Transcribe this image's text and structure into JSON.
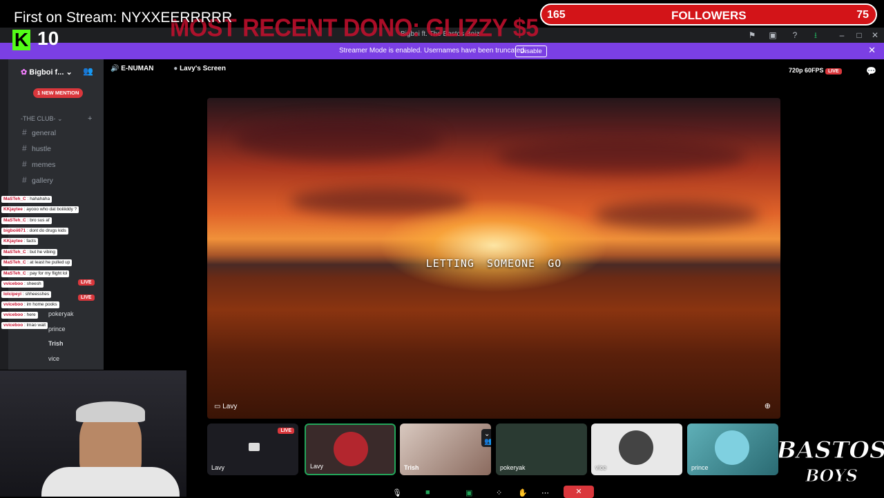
{
  "overlay": {
    "first_on_stream": "First on Stream: NYXXEERRRRR",
    "recent_dono": "MOST RECENT DONO: GLIZZY $5",
    "kick_count": "10",
    "followers_current": "165",
    "followers_label": "FOLLOWERS",
    "followers_goal": "75",
    "brand_logo": "BASTOS BOYS"
  },
  "window": {
    "title": "Bigboi ft. The Bastos Boiz"
  },
  "banner": {
    "message": "Streamer Mode is enabled. Usernames have been truncated.",
    "disable_label": "Disable"
  },
  "sidebar": {
    "server_name": "Bigboi f...",
    "mention_badge": "1 NEW MENTION",
    "category": "-THE CLUB-",
    "channels": [
      "general",
      "hustle",
      "memes",
      "gallery"
    ],
    "voice_users": [
      {
        "name": "pokeryak"
      },
      {
        "name": "prince"
      },
      {
        "name": "Trish"
      },
      {
        "name": "vice"
      }
    ],
    "live_label": "LIVE"
  },
  "chat": [
    {
      "user": "MaSTeh_C",
      "text": ": hahahaha"
    },
    {
      "user": "KKjaytee",
      "text": ": ayooo who dat boiiiiddy ?"
    },
    {
      "user": "MaSTeh_C",
      "text": ": bro sus af"
    },
    {
      "user": "bigboii671",
      "text": ": dont do drugs kids"
    },
    {
      "user": "KKjaytee",
      "text": ": facts"
    },
    {
      "user": "MaSTeh_C",
      "text": ": but he vibing"
    },
    {
      "user": "MaSTeh_C",
      "text": ": at least he pulled up"
    },
    {
      "user": "MaSTeh_C",
      "text": ": pay for my flight lol"
    },
    {
      "user": "vviceboo",
      "text": ": sheesh"
    },
    {
      "user": "lolcipeyi",
      "text": ": shheesshes"
    },
    {
      "user": "vviceboo",
      "text": ": im home pooks"
    },
    {
      "user": "vviceboo",
      "text": ": here"
    },
    {
      "user": "vviceboo",
      "text": ": lmao wait"
    }
  ],
  "call": {
    "voice_channel": "E-NUMAN",
    "screen_title": "Lavy's Screen",
    "quality": "720p 60FPS",
    "live_label": "LIVE",
    "lyric": "LETTING SOMEONE GO",
    "main_label": "Lavy",
    "tiles": [
      {
        "name": "Lavy",
        "live": "LIVE"
      },
      {
        "name": "Lavy"
      },
      {
        "name": "Trish"
      },
      {
        "name": "pokeryak"
      },
      {
        "name": "vice"
      },
      {
        "name": "prince"
      }
    ]
  },
  "colors": {
    "discord_bg": "#2b2d31",
    "banner_purple": "#7b3fe4",
    "live_red": "#da373c",
    "kick_green": "#53fc18",
    "follower_red": "#d31418"
  }
}
